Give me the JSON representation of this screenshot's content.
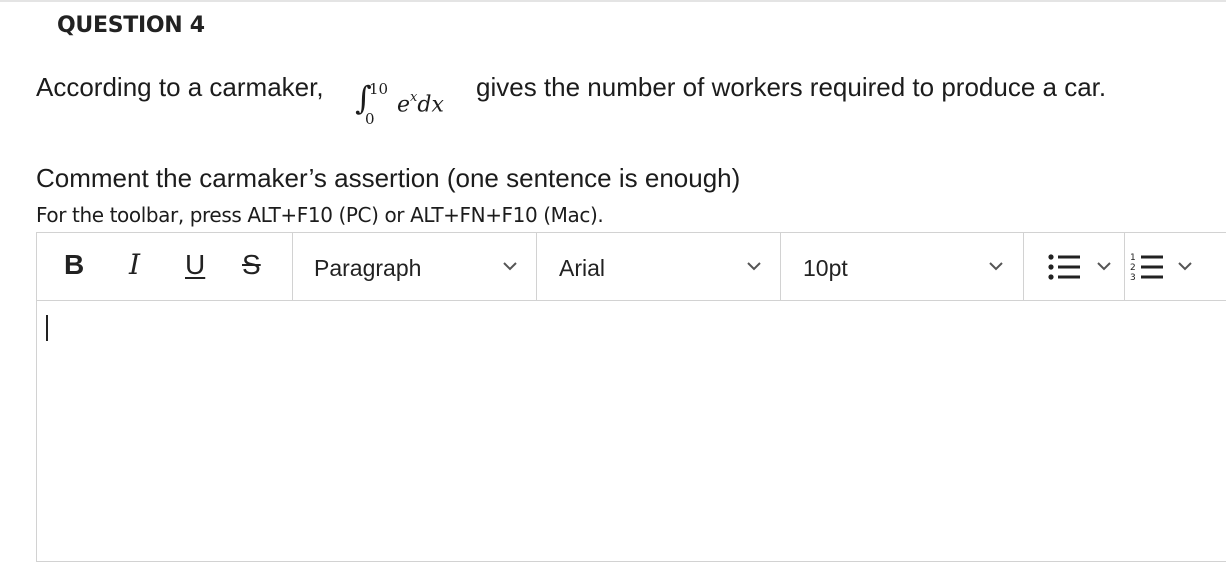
{
  "question": {
    "title": "QUESTION 4",
    "prompt_before": "According to a carmaker,",
    "math": {
      "integral_sign": "∫",
      "upper_limit": "10",
      "lower_limit": "0",
      "base": "e",
      "exponent": "x",
      "differential": "dx"
    },
    "prompt_after": "gives the number of workers required to produce a car.",
    "instruction": "Comment the carmaker’s assertion (one sentence is enough)",
    "toolbar_hint": "For the toolbar, press ALT+F10 (PC) or ALT+FN+F10 (Mac)."
  },
  "toolbar": {
    "bold": "B",
    "italic": "I",
    "underline": "U",
    "strikethrough": "S",
    "paragraph_select": "Paragraph",
    "font_select": "Arial",
    "size_select": "10pt",
    "bullet_list_icon": "bullet-list-icon",
    "numbered_list_icon": "numbered-list-icon"
  },
  "colors": {
    "text": "#1c1c1c",
    "border": "#d2d2d2",
    "background": "#ffffff"
  }
}
